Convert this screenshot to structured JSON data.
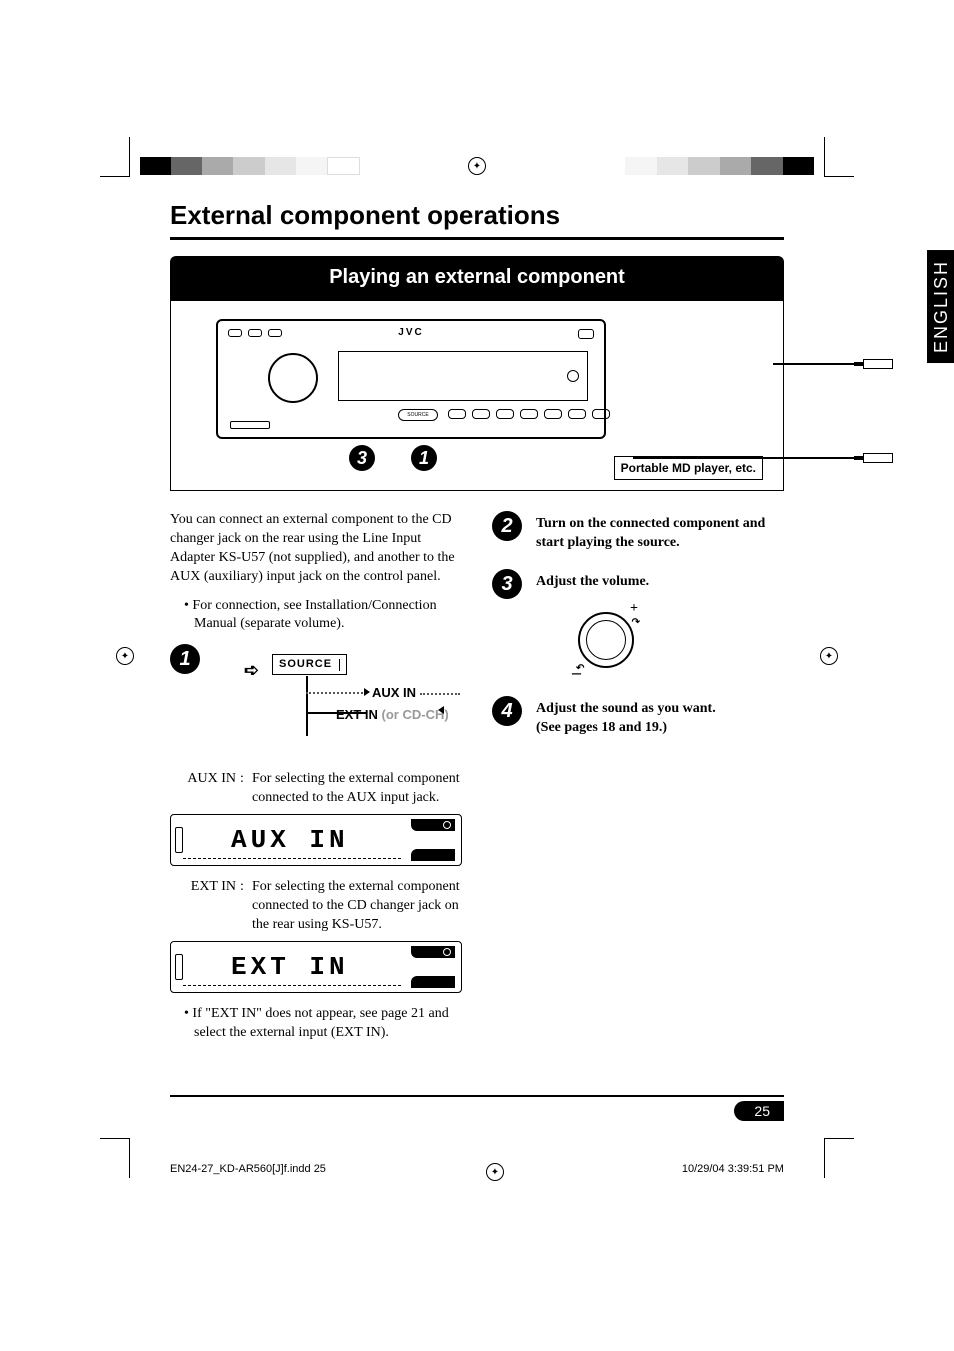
{
  "language_tab": "ENGLISH",
  "section_title": "External component operations",
  "banner": "Playing an external component",
  "figure": {
    "brand": "JVC",
    "source_btn": "SOURCE",
    "callout_3": "3",
    "callout_1": "1",
    "device_box": "Portable MD player, etc."
  },
  "left_col": {
    "intro": "You can connect an external component to the CD changer jack on the rear using the Line Input Adapter KS-U57 (not supplied), and another to the AUX (auxiliary) input jack on the control panel.",
    "bullet1": "For connection, see Installation/Connection Manual (separate volume).",
    "step1_num": "1",
    "source_label": "SOURCE",
    "aux_in_label": "AUX IN",
    "ext_in_label": "EXT IN",
    "ext_in_gray": " (or CD-CH)",
    "aux_term": "AUX IN",
    "aux_def": "For selecting the external component connected to the AUX input jack.",
    "lcd_aux": "AUX  IN",
    "ext_term": "EXT IN",
    "ext_def": "For selecting the external component connected to the CD changer jack on the rear using KS-U57.",
    "lcd_ext": "EXT  IN",
    "bullet2": "If \"EXT IN\" does not appear, see page 21 and select the external input (EXT IN)."
  },
  "right_col": {
    "step2_num": "2",
    "step2": "Turn on the connected component and start playing the source.",
    "step3_num": "3",
    "step3": "Adjust the volume.",
    "plus": "+",
    "minus": "–",
    "step4_num": "4",
    "step4_line1": "Adjust the sound as you want.",
    "step4_line2": "(See pages 18 and 19.)"
  },
  "page_number": "25",
  "footer": {
    "left": "EN24-27_KD-AR560[J]f.indd   25",
    "right": "10/29/04   3:39:51 PM"
  }
}
